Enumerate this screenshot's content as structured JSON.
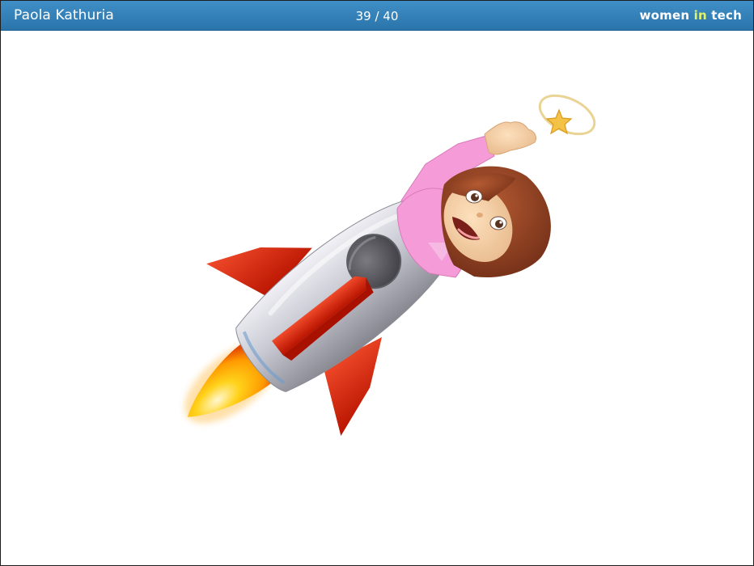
{
  "header": {
    "presenter_name": "Paola Kathuria",
    "current_slide": "39",
    "separator": " / ",
    "total_slides": "40",
    "brand": {
      "part1": "women ",
      "part2": "in",
      "part3": " tech"
    }
  },
  "colors": {
    "header_bar": "#2e7cb6",
    "brand_accent": "#e0f36a",
    "rocket_body": "#bfbfc9",
    "rocket_fins": "#dd2a12",
    "flame": "#ffb400",
    "shirt": "#f59ad9",
    "hair": "#8a3a1e",
    "skin": "#f6cfa4",
    "star": "#f3c247"
  },
  "slide": {
    "image": {
      "icon": "woman-riding-rocket-emoji-icon"
    }
  }
}
